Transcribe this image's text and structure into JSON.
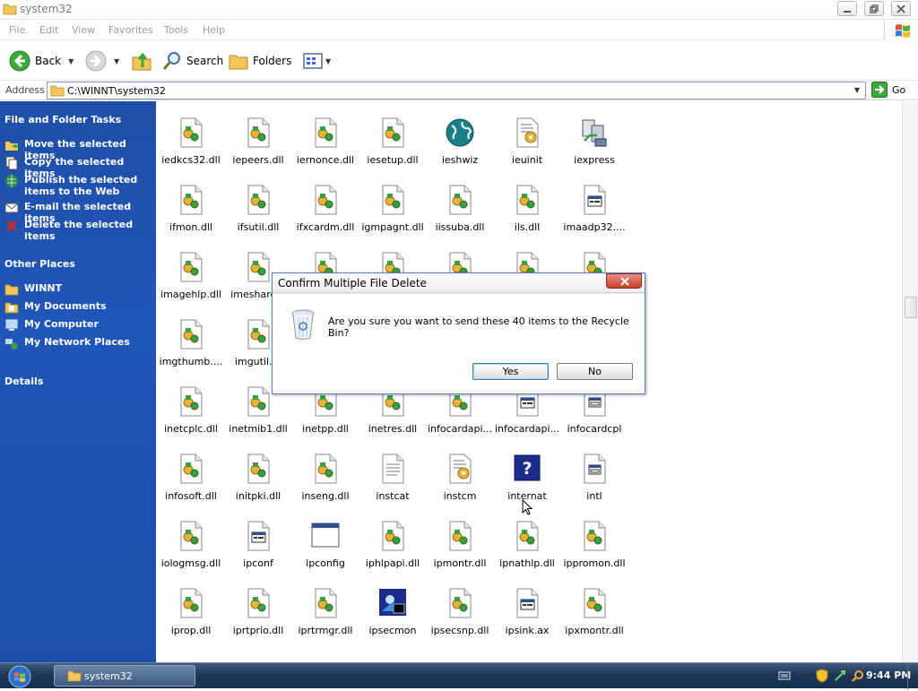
{
  "window": {
    "title": "system32",
    "buttons": [
      "minimize",
      "restore",
      "close"
    ]
  },
  "menu": {
    "items": [
      "File",
      "Edit",
      "View",
      "Favorites",
      "Tools",
      "Help"
    ]
  },
  "toolbar": {
    "back": "Back",
    "search": "Search",
    "folders": "Folders"
  },
  "address": {
    "label": "Address",
    "value": "C:\\WINNT\\system32",
    "go": "Go"
  },
  "taskpane": {
    "file_tasks": {
      "header": "File and Folder Tasks",
      "items": [
        {
          "label": "Move the selected items",
          "icon": "move-icon"
        },
        {
          "label": "Copy the selected items",
          "icon": "copy-icon"
        },
        {
          "label": "Publish the selected items to the Web",
          "icon": "publish-icon"
        },
        {
          "label": "E-mail the selected items",
          "icon": "email-icon"
        },
        {
          "label": "Delete the selected items",
          "icon": "delete-icon"
        }
      ]
    },
    "other_places": {
      "header": "Other Places",
      "items": [
        {
          "label": "WINNT",
          "icon": "folder-icon"
        },
        {
          "label": "My Documents",
          "icon": "my-documents-icon"
        },
        {
          "label": "My Computer",
          "icon": "my-computer-icon"
        },
        {
          "label": "My Network Places",
          "icon": "network-icon"
        }
      ]
    },
    "details": {
      "header": "Details"
    }
  },
  "files": [
    {
      "name": "iedkcs32.dll",
      "icon": "dll"
    },
    {
      "name": "iepeers.dll",
      "icon": "dll"
    },
    {
      "name": "iernonce.dll",
      "icon": "dll"
    },
    {
      "name": "iesetup.dll",
      "icon": "dll"
    },
    {
      "name": "ieshwiz",
      "icon": "globe"
    },
    {
      "name": "ieuinit",
      "icon": "inf"
    },
    {
      "name": "iexpress",
      "icon": "express"
    },
    {
      "name": "ifmon.dll",
      "icon": "dll"
    },
    {
      "name": "ifsutil.dll",
      "icon": "dll"
    },
    {
      "name": "ifxcardm.dll",
      "icon": "dll"
    },
    {
      "name": "igmpagnt.dll",
      "icon": "dll"
    },
    {
      "name": "iissuba.dll",
      "icon": "dll"
    },
    {
      "name": "ils.dll",
      "icon": "dll"
    },
    {
      "name": "imaadp32....",
      "icon": "sys"
    },
    {
      "name": "imagehlp.dll",
      "icon": "dll"
    },
    {
      "name": "imeshare...",
      "icon": "dll"
    },
    {
      "name": "",
      "icon": "dll"
    },
    {
      "name": "",
      "icon": "dll"
    },
    {
      "name": "",
      "icon": "dll"
    },
    {
      "name": "",
      "icon": "dll"
    },
    {
      "name": "",
      "icon": "dll"
    },
    {
      "name": "imgthumb....",
      "icon": "dll"
    },
    {
      "name": "imgutil....",
      "icon": "dll"
    },
    {
      "name": "",
      "icon": "none"
    },
    {
      "name": "",
      "icon": "none"
    },
    {
      "name": "",
      "icon": "none"
    },
    {
      "name": "",
      "icon": "none"
    },
    {
      "name": "",
      "icon": "none"
    },
    {
      "name": "inetcplc.dll",
      "icon": "dll"
    },
    {
      "name": "inetmib1.dll",
      "icon": "dll"
    },
    {
      "name": "inetpp.dll",
      "icon": "dll"
    },
    {
      "name": "inetres.dll",
      "icon": "dll"
    },
    {
      "name": "infocardapi...",
      "icon": "dll"
    },
    {
      "name": "infocardapi...",
      "icon": "sys"
    },
    {
      "name": "infocardcpl",
      "icon": "cpl"
    },
    {
      "name": "infosoft.dll",
      "icon": "dll"
    },
    {
      "name": "initpki.dll",
      "icon": "dll"
    },
    {
      "name": "inseng.dll",
      "icon": "dll"
    },
    {
      "name": "instcat",
      "icon": "txt"
    },
    {
      "name": "instcm",
      "icon": "inf"
    },
    {
      "name": "internat",
      "icon": "help"
    },
    {
      "name": "intl",
      "icon": "cpl"
    },
    {
      "name": "iologmsg.dll",
      "icon": "dll"
    },
    {
      "name": "ipconf",
      "icon": "sys"
    },
    {
      "name": "ipconfig",
      "icon": "window"
    },
    {
      "name": "iphlpapi.dll",
      "icon": "dll"
    },
    {
      "name": "ipmontr.dll",
      "icon": "dll"
    },
    {
      "name": "ipnathlp.dll",
      "icon": "dll"
    },
    {
      "name": "ippromon.dll",
      "icon": "dll"
    },
    {
      "name": "iprop.dll",
      "icon": "dll"
    },
    {
      "name": "iprtprio.dll",
      "icon": "dll"
    },
    {
      "name": "iprtrmgr.dll",
      "icon": "dll"
    },
    {
      "name": "ipsecmon",
      "icon": "ipsec"
    },
    {
      "name": "ipsecsnp.dll",
      "icon": "dll"
    },
    {
      "name": "ipsink.ax",
      "icon": "sys"
    },
    {
      "name": "ipxmontr.dll",
      "icon": "dll"
    }
  ],
  "dialog": {
    "title": "Confirm Multiple File Delete",
    "message": "Are you sure you want to send these 40 items to the Recycle Bin?",
    "yes": "Yes",
    "no": "No",
    "icon": "recycle-bin-icon"
  },
  "taskbar": {
    "task_label": "system32",
    "clock": "9:44 PM"
  },
  "colors": {
    "taskpane_blue": "#2056b9",
    "taskbar": "#1f3656"
  }
}
